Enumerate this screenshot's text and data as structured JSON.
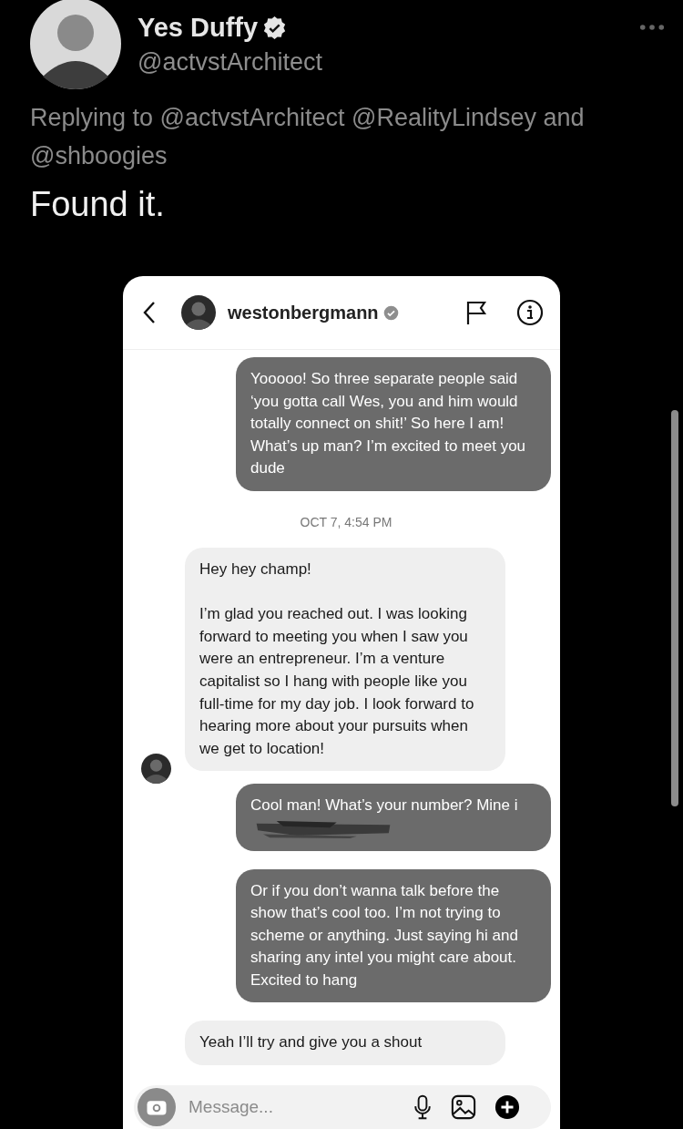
{
  "tweet": {
    "author": {
      "name": "Yes Duffy",
      "handle": "@actvstArchitect",
      "verified": true
    },
    "replying_to": "Replying to @actvstArchitect @RealityLindsey and @shboogies",
    "text": "Found it.",
    "screenshot": {
      "header": {
        "username": "westonbergmann",
        "verified": true
      },
      "messages": [
        {
          "kind": "sent",
          "text": "Yooooo!  So three separate people said ‘you gotta call Wes, you and him would totally connect on shit!’ So here I am! What’s up man? I’m excited to meet you dude"
        },
        {
          "kind": "timestamp",
          "text": "OCT 7, 4:54 PM"
        },
        {
          "kind": "received",
          "avatar": true,
          "text": "Hey hey champ!\n\nI’m glad you reached out. I was looking forward to meeting you when I saw you were an entrepreneur. I’m a venture capitalist so I hang with people like you full-time for my day job. I look forward to hearing more about your pursuits when we get to location!"
        },
        {
          "kind": "sent",
          "redacted": true,
          "text": "Cool man! What’s your number? Mine i"
        },
        {
          "kind": "sent",
          "text": "Or if you don’t wanna talk before the show that’s cool too. I’m not trying to scheme or anything. Just saying hi and sharing any intel you might care about. Excited to hang"
        },
        {
          "kind": "received",
          "avatar": false,
          "text": "Yeah I’ll try and give you a shout"
        }
      ],
      "composer": {
        "placeholder": "Message..."
      }
    }
  }
}
